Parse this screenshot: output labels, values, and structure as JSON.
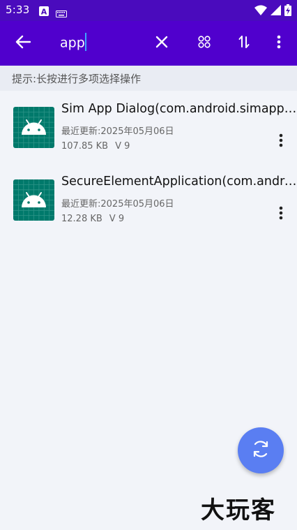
{
  "status_bar": {
    "time": "5:33",
    "icons": [
      "a-letter-icon",
      "keyboard-icon",
      "wifi-icon",
      "signal-icon",
      "battery-charging-icon"
    ]
  },
  "app_bar": {
    "search_value": "app",
    "icons": [
      "back-arrow-icon",
      "clear-icon",
      "grid-view-icon",
      "sort-icon",
      "more-vert-icon"
    ]
  },
  "hint": "提示:长按进行多项选择操作",
  "apps": [
    {
      "name": "Sim App Dialog(com.android.simappdialog)",
      "updated": "最近更新:2025年05月06日",
      "size": "107.85 KB",
      "version": "V 9"
    },
    {
      "name": "SecureElementApplication(com.android.se)",
      "updated": "最近更新:2025年05月06日",
      "size": "12.28 KB",
      "version": "V 9"
    }
  ],
  "fab": {
    "icon": "refresh-icon"
  },
  "watermark": "大玩客",
  "colors": {
    "status_bar": "#4a0bbd",
    "app_bar": "#5000cd",
    "background": "#f2f4f9",
    "app_icon": "#00796b",
    "fab": "#5a7ef2"
  }
}
